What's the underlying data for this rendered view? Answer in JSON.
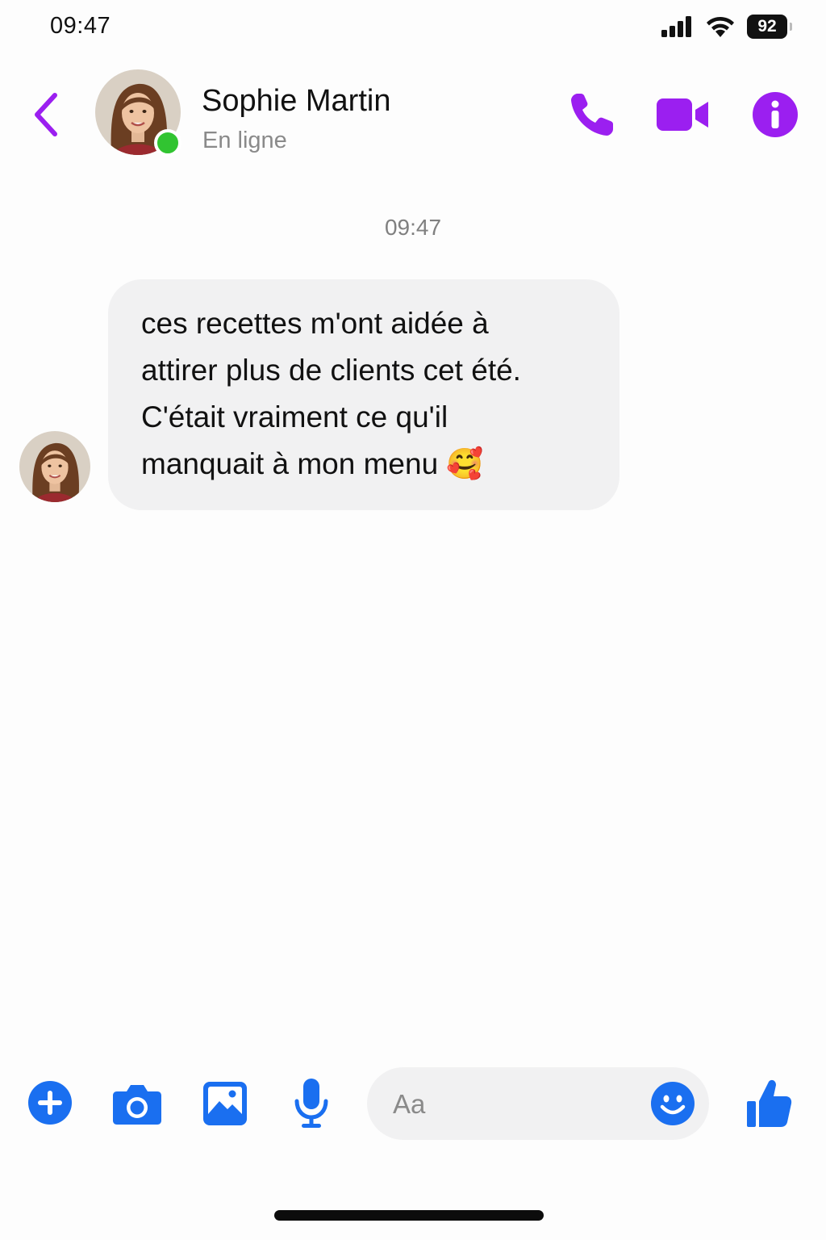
{
  "status_bar": {
    "time": "09:47",
    "battery": "92",
    "icons": [
      "signal-icon",
      "wifi-icon",
      "battery-icon"
    ]
  },
  "header": {
    "back_icon": "chevron-left-icon",
    "contact_name": "Sophie Martin",
    "contact_status": "En ligne",
    "actions": [
      "phone-icon",
      "video-camera-icon",
      "info-icon"
    ]
  },
  "conversation": {
    "timestamp": "09:47",
    "messages": [
      {
        "sender": "Sophie Martin",
        "lines": [
          "ces recettes m'ont aidée à",
          "attirer plus de clients cet été.",
          "C'était vraiment ce qu'il",
          "manquait à mon menu 🥰"
        ]
      }
    ]
  },
  "composer": {
    "tools": [
      "plus-icon",
      "camera-icon",
      "image-icon",
      "microphone-icon"
    ],
    "input_value": "",
    "input_placeholder": "Aa",
    "emoji_icon": "smiley-icon",
    "send_icon": "thumbs-up-icon"
  },
  "colors": {
    "accent_purple": "#9b1ff0",
    "accent_blue": "#1a6ff0",
    "online_green": "#31c431",
    "bubble_gray": "#f1f1f2",
    "muted_text": "#8a8a8a"
  }
}
